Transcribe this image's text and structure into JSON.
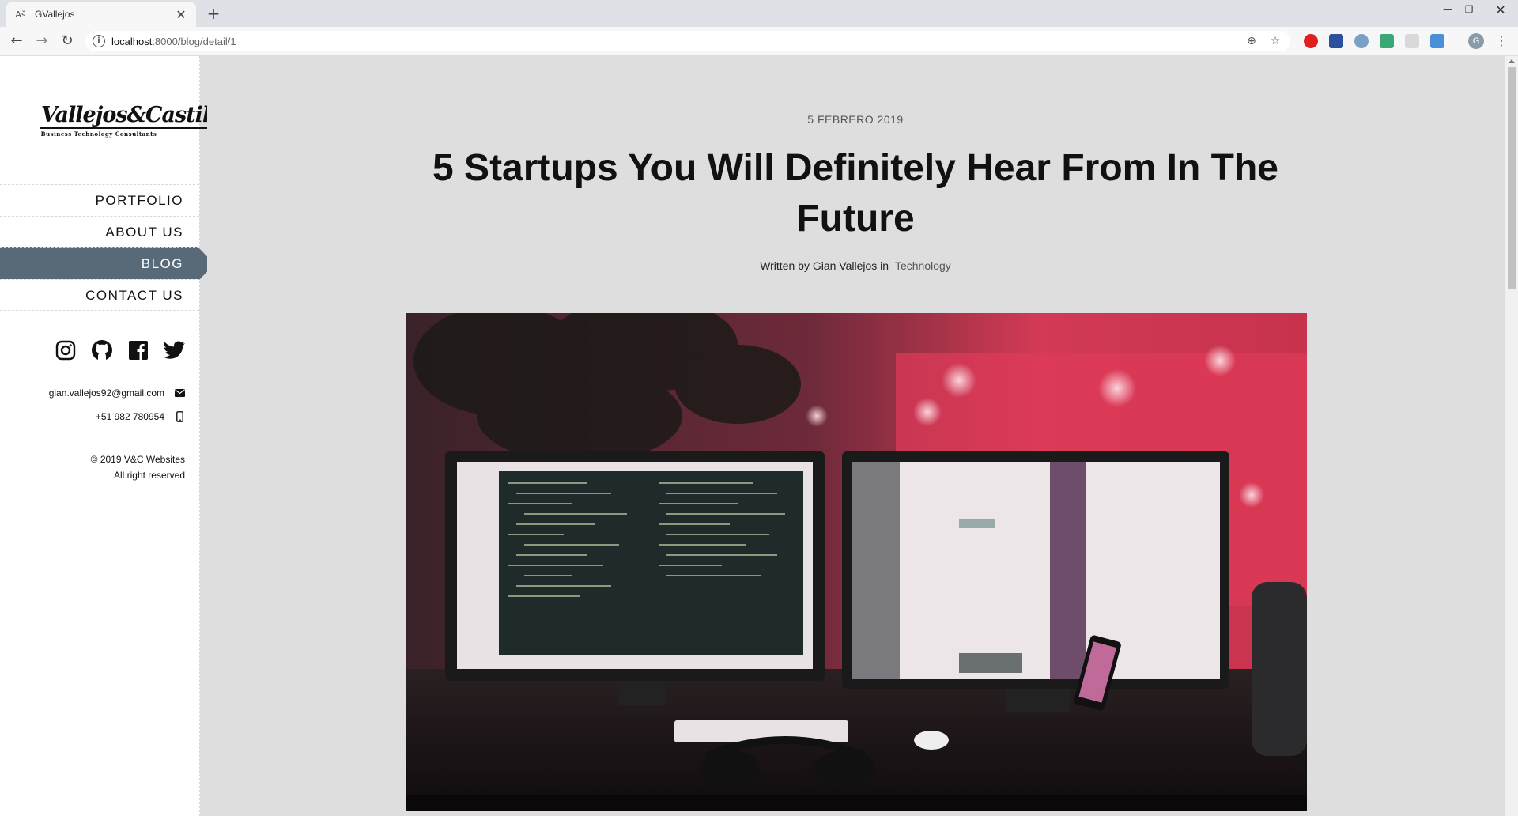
{
  "browser": {
    "tab_title": "GVallejos",
    "tab_favicon": "Aš",
    "url_host": "localhost",
    "url_path": ":8000/blog/detail/1",
    "avatar_letter": "G"
  },
  "sidebar": {
    "logo_main": "Vallejos&Castillo",
    "logo_sub": "Business Technology Consultants",
    "menu": [
      {
        "label": "PORTFOLIO"
      },
      {
        "label": "ABOUT US"
      },
      {
        "label": "BLOG"
      },
      {
        "label": "CONTACT US"
      }
    ],
    "email": "gian.vallejos92@gmail.com",
    "phone": "+51 982 780954",
    "copyright_line1": "© 2019 V&C Websites",
    "copyright_line2": "All right reserved"
  },
  "post": {
    "date": "5 FEBRERO 2019",
    "title": "5 Startups You Will Definitely Hear From In The Future",
    "byline": "Written by Gian Vallejos in",
    "category": "Technology"
  },
  "colors": {
    "active_menu_bg": "#586a78",
    "page_bg": "#dedede",
    "sidebar_bg": "#ffffff"
  }
}
